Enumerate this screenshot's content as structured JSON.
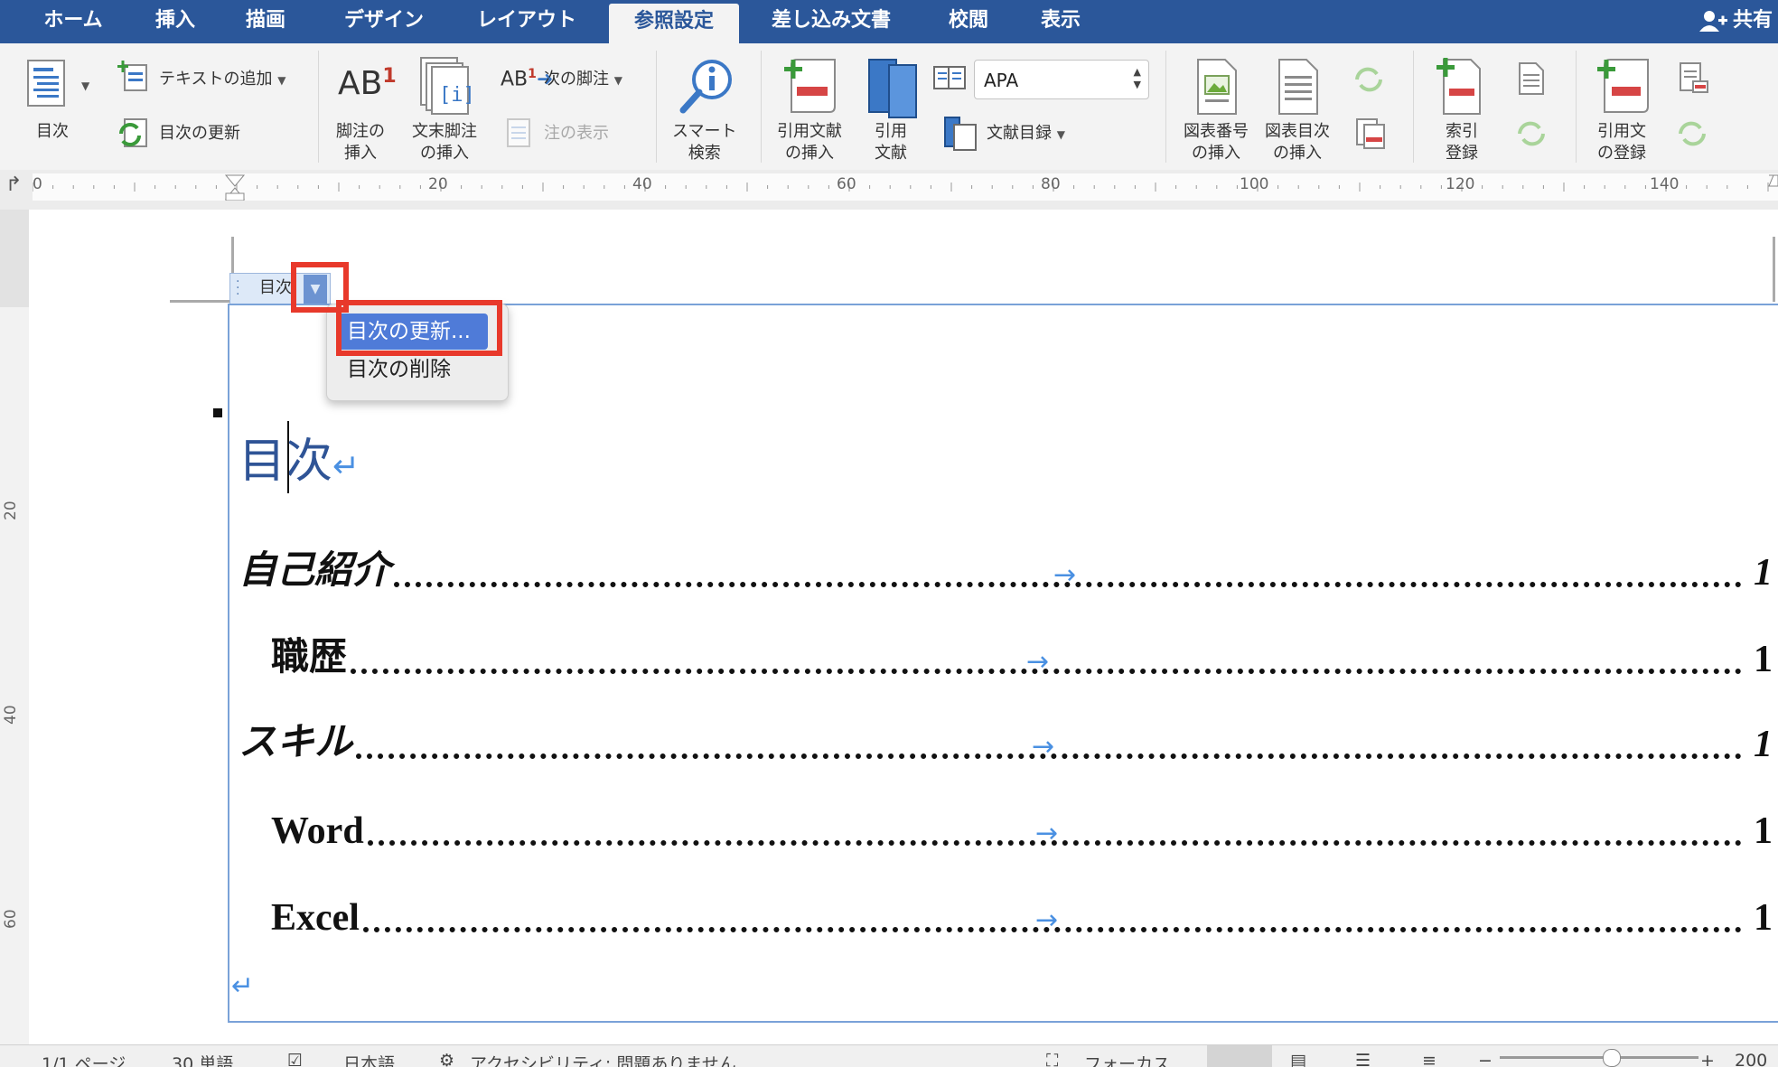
{
  "tabs": [
    {
      "label": "ホーム",
      "active": false
    },
    {
      "label": "挿入",
      "active": false
    },
    {
      "label": "描画",
      "active": false
    },
    {
      "label": "デザイン",
      "active": false
    },
    {
      "label": "レイアウト",
      "active": false
    },
    {
      "label": "参照設定",
      "active": true
    },
    {
      "label": "差し込み文書",
      "active": false
    },
    {
      "label": "校閲",
      "active": false
    },
    {
      "label": "表示",
      "active": false
    }
  ],
  "share_label": "共有",
  "ribbon": {
    "toc": "目次",
    "add_text": "テキストの追加",
    "update_toc": "目次の更新",
    "footnote_line1": "脚注の",
    "footnote_line2": "挿入",
    "endnote_line1": "文末脚注",
    "endnote_line2": "の挿入",
    "next_footnote": "次の脚注",
    "show_notes": "注の表示",
    "smart_line1": "スマート",
    "smart_line2": "検索",
    "insert_citation_line1": "引用文献",
    "insert_citation_line2": "の挿入",
    "citations_line1": "引用",
    "citations_line2": "文献",
    "style_value": "APA",
    "bibliography": "文献目録",
    "insert_caption_line1": "図表番号",
    "insert_caption_line2": "の挿入",
    "insert_tof_line1": "図表目次",
    "insert_tof_line2": "の挿入",
    "mark_entry_line1": "索引",
    "mark_entry_line2": "登録",
    "mark_citation_line1": "引用文",
    "mark_citation_line2": "の登録",
    "ab_text": "AB",
    "ab_sup": "1",
    "ab_small": "AB",
    "endnote_glyph": "[i]"
  },
  "ruler": {
    "h_numbers": [
      "0",
      "20",
      "40",
      "60",
      "80",
      "100",
      "120",
      "140"
    ],
    "v_numbers": [
      "20",
      "40",
      "60"
    ],
    "corner_glyph": "↱"
  },
  "content_control": {
    "tab_label": "目次",
    "dropdown_glyph": "▼",
    "menu": [
      {
        "label": "目次の更新...",
        "selected": true
      },
      {
        "label": "目次の削除",
        "selected": false
      }
    ]
  },
  "document": {
    "toc_title": "目次",
    "return_mark": "↵",
    "tab_arrow": "→",
    "entries": [
      {
        "text": "自己紹介",
        "page": "1",
        "level": 1
      },
      {
        "text": "職歴",
        "page": "1",
        "level": 2
      },
      {
        "text": "スキル",
        "page": "1",
        "level": 1
      },
      {
        "text": "Word",
        "page": "1",
        "level": 2
      },
      {
        "text": "Excel",
        "page": "1",
        "level": 2
      }
    ]
  },
  "status": {
    "page": "1/1 ページ",
    "words": "30 単語",
    "language": "日本語",
    "accessibility": "アクセシビリティ: 問題ありません",
    "focus": "フォーカス",
    "zoom": "200"
  },
  "colors": {
    "tab_bar": "#2b579a",
    "highlight": "#e8392b",
    "menu_selected": "#4f7bd8",
    "toc_title": "#2f5496"
  }
}
